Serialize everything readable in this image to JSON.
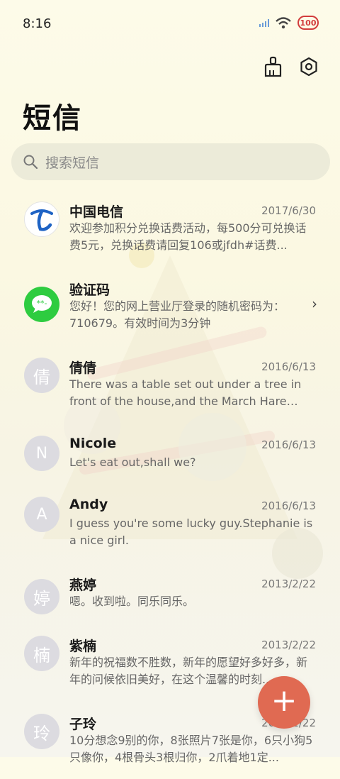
{
  "status_bar": {
    "time": "8:16",
    "battery": "100"
  },
  "header": {
    "title": "短信",
    "clean_icon": "broom-icon",
    "settings_icon": "gear-icon"
  },
  "search": {
    "placeholder": "搜索短信",
    "icon": "search-icon"
  },
  "conversations": [
    {
      "name": "中国电信",
      "date": "2017/6/30",
      "avatar_type": "logo",
      "preview": "欢迎参加积分兑换话费活动，每500分可兑换话费5元，兑换话费请回复106或jfdh#话费..."
    },
    {
      "name": "验证码",
      "date": "",
      "avatar_type": "message-logo",
      "preview": "您好！您的网上营业厅登录的随机密码为：710679。有效时间为3分钟"
    },
    {
      "name": "倩倩",
      "date": "2016/6/13",
      "avatar": "倩",
      "preview": "There was a table set out under a tree in front of the house,and the March Hare an..."
    },
    {
      "name": "Nicole",
      "date": "2016/6/13",
      "avatar": "N",
      "preview": "Let's eat out,shall we?"
    },
    {
      "name": "Andy",
      "date": "2016/6/13",
      "avatar": "A",
      "preview": "I guess you're some lucky guy.Stephanie is a nice girl."
    },
    {
      "name": "燕婷",
      "date": "2013/2/22",
      "avatar": "婷",
      "preview": "嗯。收到啦。同乐同乐。"
    },
    {
      "name": "紫楠",
      "date": "2013/2/22",
      "avatar": "楠",
      "preview": "新年的祝福数不胜数，新年的愿望好多好多，新年的问候依旧美好，在这个温馨的时刻..."
    },
    {
      "name": "子玲",
      "date": "2013/2/22",
      "avatar": "玲",
      "preview": "10分想念9别的你，8张照片7张是你，6只小狗5只像你，4根骨头3根归你，2爪着地1定..."
    }
  ],
  "fab": {
    "label": "+",
    "icon": "plus-icon"
  },
  "colors": {
    "fab": "#e06a52",
    "search_bg": "#ecebd9",
    "telecom_blue": "#1e63c4",
    "message_green": "#2ecc40"
  }
}
